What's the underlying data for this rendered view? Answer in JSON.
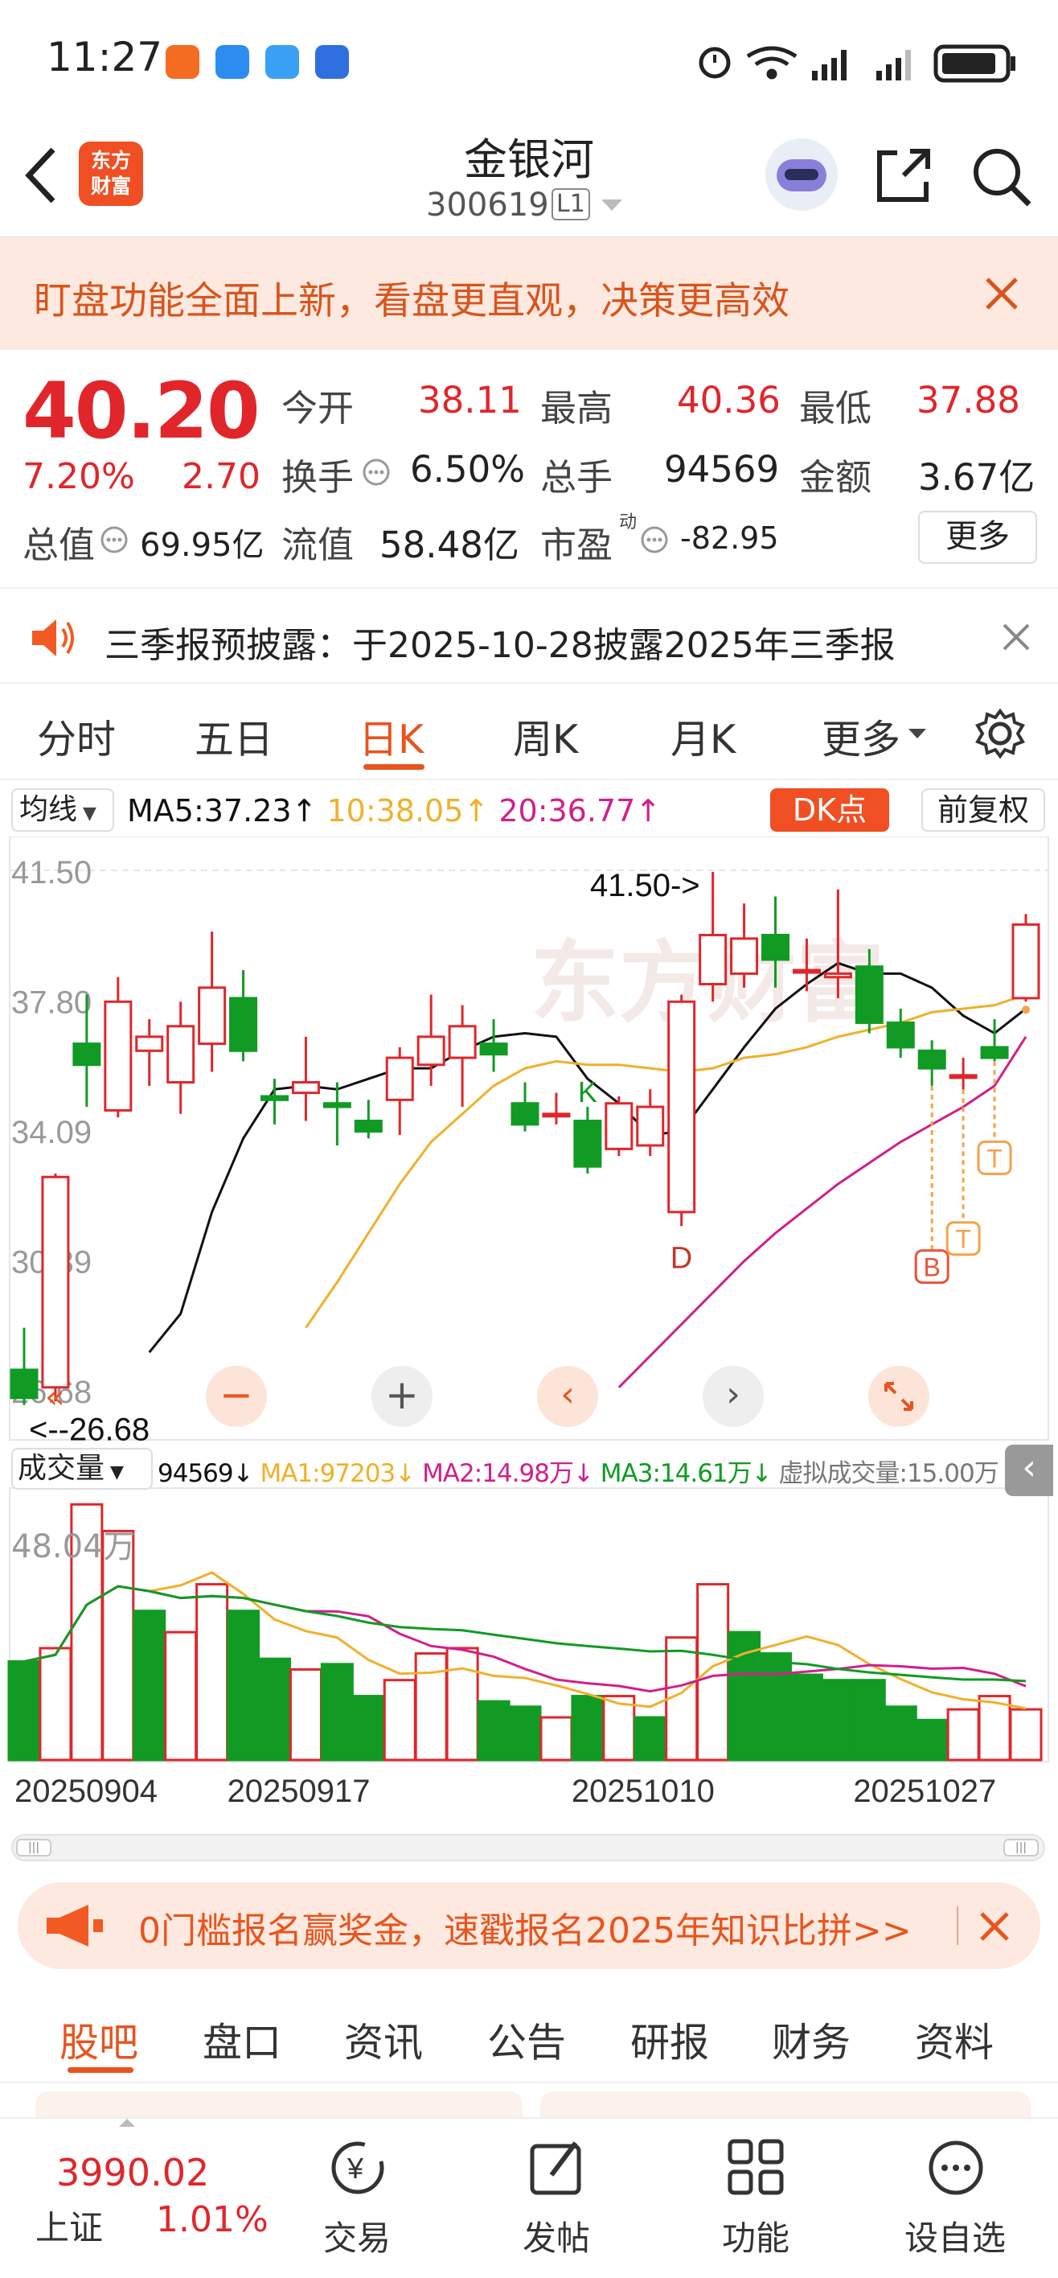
{
  "status_bar": {
    "time": "11:27"
  },
  "header": {
    "logo_text_top": "东方",
    "logo_text_bottom": "财富",
    "stock_name": "金银河",
    "stock_code": "300619",
    "level_badge": "L1"
  },
  "promo_banner": {
    "text": "盯盘功能全面上新，看盘更直观，决策更高效"
  },
  "quote": {
    "price": "40.20",
    "change_pct": "7.20%",
    "change_amt": "2.70",
    "open_label": "今开",
    "open": "38.11",
    "high_label": "最高",
    "high": "40.36",
    "low_label": "最低",
    "low": "37.88",
    "turnover_label": "换手",
    "turnover": "6.50%",
    "volume_label": "总手",
    "volume": "94569",
    "amount_label": "金额",
    "amount": "3.67亿",
    "mktcap_label": "总值",
    "mktcap": "69.95亿",
    "float_label": "流值",
    "float_cap": "58.48亿",
    "pe_label": "市盈",
    "pe_sup": "动",
    "pe": "-82.95",
    "more_button": "更多"
  },
  "notice": {
    "text": "三季报预披露：于2025-10-28披露2025年三季报"
  },
  "period_tabs": [
    "分时",
    "五日",
    "日K",
    "周K",
    "月K",
    "更多"
  ],
  "active_period": "日K",
  "kline": {
    "indicator_select": "均线",
    "ma5": "MA5:37.23",
    "ma10": "10:38.05",
    "ma20": "20:36.77",
    "dk_button": "DK点",
    "adjust_button": "前复权",
    "y_labels": [
      "41.50",
      "37.80",
      "34.09",
      "30.39",
      "26.68"
    ],
    "high_annotation": "41.50->",
    "low_annotation": "<--26.68",
    "signal_labels": {
      "k": "K",
      "d": "D",
      "b": "B",
      "t": "T"
    },
    "colors": {
      "up": "#e0262b",
      "down": "#119b24",
      "ma5": "#111111",
      "ma10": "#f0b02a",
      "ma20": "#d11f8c"
    }
  },
  "volume_panel": {
    "select": "成交量",
    "vol": "94569",
    "ma1": "MA1:97203",
    "ma2": "MA2:14.98万",
    "ma3": "MA3:14.61万",
    "virtual": "虚拟成交量:15.00万",
    "max_label": "48.04万",
    "dates": [
      "20250904",
      "20250917",
      "20251010",
      "20251027"
    ]
  },
  "chart_data": {
    "type": "candlestick",
    "candles": [
      {
        "o": 27.3,
        "c": 26.5,
        "h": 28.5,
        "l": 26.3
      },
      {
        "o": 26.8,
        "c": 32.8,
        "h": 32.9,
        "l": 26.4
      },
      {
        "o": 36.6,
        "c": 36.0,
        "h": 38.0,
        "l": 34.8
      },
      {
        "o": 34.7,
        "c": 37.8,
        "h": 38.5,
        "l": 34.5
      },
      {
        "o": 36.4,
        "c": 36.8,
        "h": 37.3,
        "l": 35.4
      },
      {
        "o": 35.5,
        "c": 37.1,
        "h": 37.8,
        "l": 34.6
      },
      {
        "o": 36.6,
        "c": 38.2,
        "h": 39.8,
        "l": 35.8
      },
      {
        "o": 37.9,
        "c": 36.4,
        "h": 38.7,
        "l": 36.1
      },
      {
        "o": 35.1,
        "c": 35.0,
        "h": 35.6,
        "l": 34.3
      },
      {
        "o": 35.2,
        "c": 35.5,
        "h": 36.8,
        "l": 34.4
      },
      {
        "o": 34.9,
        "c": 34.8,
        "h": 35.5,
        "l": 33.7
      },
      {
        "o": 34.4,
        "c": 34.1,
        "h": 35.0,
        "l": 33.9
      },
      {
        "o": 35.0,
        "c": 36.2,
        "h": 36.5,
        "l": 34.0
      },
      {
        "o": 36.0,
        "c": 36.8,
        "h": 38.0,
        "l": 35.4
      },
      {
        "o": 36.2,
        "c": 37.1,
        "h": 37.7,
        "l": 34.8
      },
      {
        "o": 36.6,
        "c": 36.3,
        "h": 37.3,
        "l": 35.8
      },
      {
        "o": 34.9,
        "c": 34.3,
        "h": 35.5,
        "l": 34.1
      },
      {
        "o": 34.6,
        "c": 34.6,
        "h": 35.2,
        "l": 34.3
      },
      {
        "o": 34.4,
        "c": 33.1,
        "h": 34.8,
        "l": 32.9
      },
      {
        "o": 33.6,
        "c": 34.9,
        "h": 35.1,
        "l": 33.4
      },
      {
        "o": 33.7,
        "c": 34.8,
        "h": 35.3,
        "l": 33.4
      },
      {
        "o": 31.8,
        "c": 37.8,
        "h": 38.0,
        "l": 31.4
      },
      {
        "o": 38.3,
        "c": 39.7,
        "h": 41.5,
        "l": 37.8
      },
      {
        "o": 38.6,
        "c": 39.6,
        "h": 40.6,
        "l": 38.2
      },
      {
        "o": 39.7,
        "c": 39.0,
        "h": 40.8,
        "l": 38.2
      },
      {
        "o": 38.7,
        "c": 38.7,
        "h": 39.6,
        "l": 38.1
      },
      {
        "o": 38.5,
        "c": 38.6,
        "h": 41.0,
        "l": 37.9
      },
      {
        "o": 38.8,
        "c": 37.2,
        "h": 39.3,
        "l": 36.9
      },
      {
        "o": 37.2,
        "c": 36.5,
        "h": 37.6,
        "l": 36.2
      },
      {
        "o": 36.4,
        "c": 35.9,
        "h": 36.7,
        "l": 35.4
      },
      {
        "o": 35.7,
        "c": 35.7,
        "h": 36.2,
        "l": 35.3
      },
      {
        "o": 36.5,
        "c": 36.2,
        "h": 37.3,
        "l": 36.1
      },
      {
        "o": 37.9,
        "c": 40.0,
        "h": 40.3,
        "l": 37.8
      }
    ],
    "ma5": [
      null,
      null,
      null,
      null,
      27.8,
      28.9,
      31.8,
      33.9,
      35.3,
      35.4,
      35.3,
      35.6,
      35.9,
      35.9,
      36.4,
      36.8,
      36.9,
      36.8,
      35.6,
      34.9,
      34.0,
      34.1,
      35.3,
      36.5,
      37.6,
      38.3,
      38.9,
      38.6,
      38.6,
      38.2,
      37.4,
      36.9,
      37.6
    ],
    "ma10": [
      null,
      null,
      null,
      null,
      null,
      null,
      null,
      null,
      null,
      28.5,
      29.8,
      31.2,
      32.6,
      33.8,
      34.6,
      35.4,
      35.9,
      36.1,
      36.0,
      36.0,
      35.9,
      35.8,
      35.9,
      36.2,
      36.3,
      36.5,
      36.8,
      37.0,
      37.2,
      37.5,
      37.6,
      37.7,
      38.0
    ],
    "ma20": [
      null,
      null,
      null,
      null,
      null,
      null,
      null,
      null,
      null,
      null,
      null,
      null,
      null,
      null,
      null,
      null,
      null,
      null,
      null,
      26.8,
      27.7,
      28.6,
      29.5,
      30.4,
      31.2,
      31.9,
      32.6,
      33.2,
      33.8,
      34.3,
      34.8,
      35.4,
      36.8
    ],
    "volume_wan": [
      18.5,
      21.0,
      48.0,
      43.0,
      28.0,
      24.0,
      33.0,
      28.0,
      19.0,
      17.0,
      18.0,
      12.0,
      15.0,
      20.0,
      21.0,
      11.0,
      10.0,
      8.0,
      12.0,
      12.0,
      8.0,
      23.0,
      33.0,
      24.0,
      20.0,
      16.0,
      15.0,
      15.0,
      10.0,
      7.5,
      9.5,
      12.0,
      9.5
    ],
    "volume_up": [
      false,
      true,
      true,
      true,
      false,
      true,
      true,
      false,
      false,
      true,
      false,
      false,
      true,
      true,
      true,
      false,
      false,
      true,
      false,
      true,
      false,
      true,
      true,
      false,
      false,
      false,
      false,
      false,
      false,
      false,
      true,
      true,
      true
    ],
    "y_range": [
      26.68,
      41.5
    ],
    "dates": [
      "20250904",
      "20250917",
      "20251010",
      "20251027"
    ]
  },
  "ad_bar": {
    "text": "0门槛报名赢奖金，速戳报名2025年知识比拼>>"
  },
  "bottom_tabs": [
    "股吧",
    "盘口",
    "资讯",
    "公告",
    "研报",
    "财务",
    "资料"
  ],
  "active_bottom_tab": "股吧",
  "bottom_nav": {
    "index_value": "3990.02",
    "index_name": "上证",
    "index_change": "1.01%",
    "items": [
      "交易",
      "发帖",
      "功能",
      "设自选"
    ]
  }
}
